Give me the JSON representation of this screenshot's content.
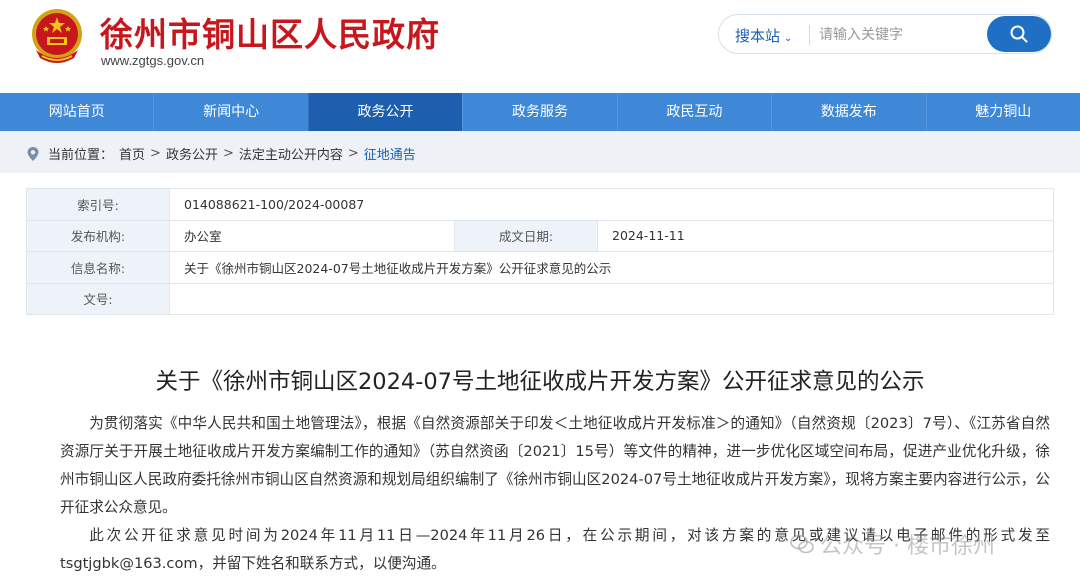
{
  "header": {
    "site_title": "徐州市铜山区人民政府",
    "site_url": "www.zgtgs.gov.cn"
  },
  "search": {
    "scope_label": "搜本站",
    "placeholder": "请输入关键字"
  },
  "nav": {
    "items": [
      {
        "label": "网站首页"
      },
      {
        "label": "新闻中心"
      },
      {
        "label": "政务公开"
      },
      {
        "label": "政务服务"
      },
      {
        "label": "政民互动"
      },
      {
        "label": "数据发布"
      },
      {
        "label": "魅力铜山"
      }
    ],
    "active_index": 2
  },
  "breadcrumb": {
    "prefix": "当前位置：",
    "items": [
      "首页",
      "政务公开",
      "法定主动公开内容",
      "征地通告"
    ],
    "separator": ">"
  },
  "info_table": {
    "index_label": "索引号:",
    "index_value": "014088621-100/2024-00087",
    "org_label": "发布机构:",
    "org_value": "办公室",
    "date_label": "成文日期:",
    "date_value": "2024-11-11",
    "name_label": "信息名称:",
    "name_value": "关于《徐州市铜山区2024-07号土地征收成片开发方案》公开征求意见的公示",
    "doc_label": "文号:",
    "doc_value": ""
  },
  "article": {
    "title": "关于《徐州市铜山区2024-07号土地征收成片开发方案》公开征求意见的公示",
    "paragraph1": "为贯彻落实《中华人民共和国土地管理法》，根据《自然资源部关于印发＜土地征收成片开发标准＞的通知》（自然资规〔2023〕7号）、《江苏省自然资源厅关于开展土地征收成片开发方案编制工作的通知》（苏自然资函〔2021〕15号）等文件的精神，进一步优化区域空间布局，促进产业优化升级，徐州市铜山区人民政府委托徐州市铜山区自然资源和规划局组织编制了《徐州市铜山区2024-07号土地征收成片开发方案》，现将方案主要内容进行公示，公开征求公众意见。",
    "paragraph2": "此次公开征求意见时间为2024年11月11日—2024年11月26日，在公示期间，对该方案的意见或建议请以电子邮件的形式发至tsgtjgbk@163.com，并留下姓名和联系方式，以便沟通。"
  },
  "watermark": {
    "text": "公众号 · 楼市徐州"
  },
  "colors": {
    "title_red": "#c8161d",
    "nav_blue": "#3f88d8",
    "nav_active": "#1d5fae",
    "link_blue": "#1a5fb4"
  }
}
